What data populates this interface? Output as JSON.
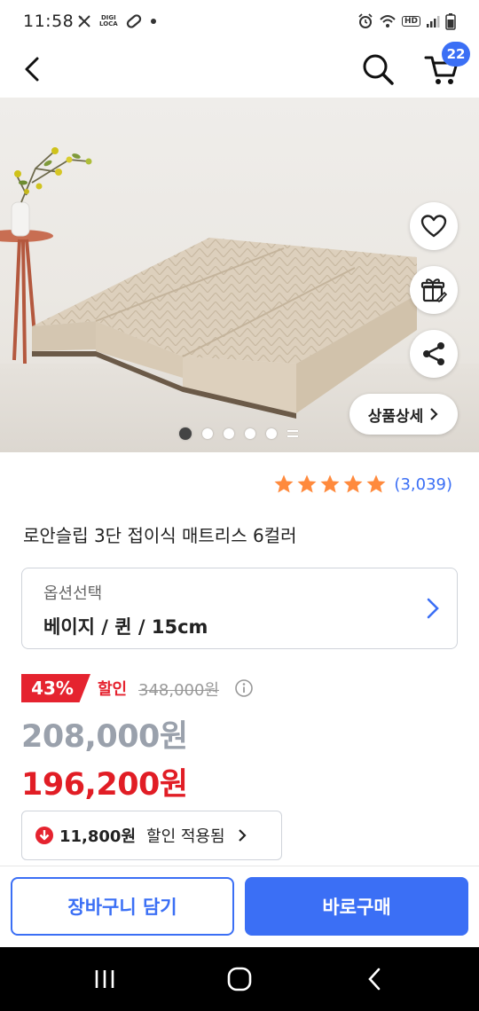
{
  "status_bar": {
    "time": "11:58",
    "digi_line1": "DIGI",
    "digi_line2": "LOCA",
    "icons": [
      "phone-missed-icon",
      "digital-locator-icon",
      "link-icon",
      "dot-icon",
      "alarm-icon",
      "wifi-icon",
      "hd-icon",
      "signal-icon",
      "battery-icon"
    ],
    "hd_label": "HD"
  },
  "top_nav": {
    "cart_count": "22",
    "icons": [
      "back-arrow-icon",
      "search-icon",
      "cart-icon"
    ],
    "accent_color": "#3b6ff5"
  },
  "hero": {
    "detail_button_label": "상품상세",
    "image_count": 5,
    "active_index": 0,
    "buttons": [
      "heart-icon",
      "gift-icon",
      "share-icon"
    ]
  },
  "rating": {
    "stars": 5,
    "review_count": "(3,039)",
    "star_color": "#ff8a3d"
  },
  "product": {
    "title": "로안슬립 3단 접이식 매트리스 6컬러"
  },
  "option": {
    "label": "옵션선택",
    "value": "베이지 / 퀸 / 15cm"
  },
  "price": {
    "discount_rate": "43%",
    "discount_label": "할인",
    "original_price": "348,000원",
    "sale_price": "208,000원",
    "final_price": "196,200원",
    "discount_color": "#e5232f"
  },
  "coupon": {
    "amount": "11,800원",
    "text": "할인 적용됨"
  },
  "cta": {
    "add_to_cart": "장바구니 담기",
    "buy_now": "바로구매"
  }
}
